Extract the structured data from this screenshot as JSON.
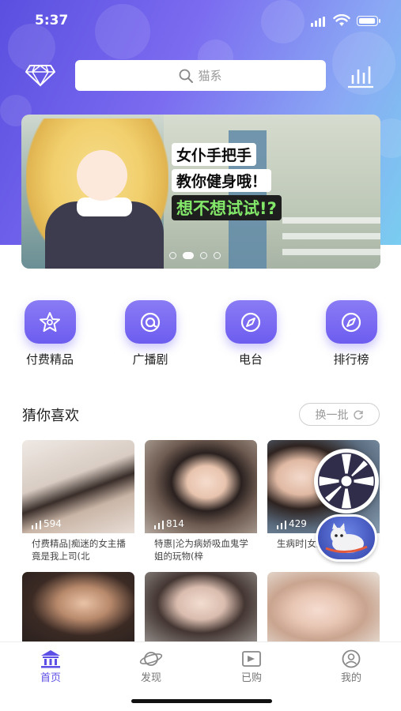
{
  "status_bar": {
    "time": "5:37"
  },
  "search": {
    "placeholder": "猫系"
  },
  "banner": {
    "lines": [
      "女仆手把手",
      "教你健身哦！",
      "想不想试试!?"
    ],
    "page_count": 4,
    "active_index": 1
  },
  "categories": [
    {
      "label": "付费精品",
      "icon": "star-icon"
    },
    {
      "label": "广播剧",
      "icon": "at-icon"
    },
    {
      "label": "电台",
      "icon": "compass-icon"
    },
    {
      "label": "排行榜",
      "icon": "compass-icon"
    }
  ],
  "recommend": {
    "title": "猜你喜欢",
    "refresh_label": "换一批",
    "cards": [
      {
        "plays": "594",
        "caption": "付费精品|痴迷的女主播竟是我上司(北"
      },
      {
        "plays": "814",
        "caption": "特惠|沦为病娇吸血鬼学姐的玩物(梓"
      },
      {
        "plays": "429",
        "caption": "生病时|女友(狸,"
      }
    ]
  },
  "tabbar": {
    "items": [
      {
        "label": "首页",
        "icon": "home-icon",
        "active": true
      },
      {
        "label": "发现",
        "icon": "planet-icon",
        "active": false
      },
      {
        "label": "已购",
        "icon": "purchased-icon",
        "active": false
      },
      {
        "label": "我的",
        "icon": "profile-icon",
        "active": false
      }
    ]
  },
  "colors": {
    "accent": "#5c4fe6",
    "header_start": "#5a4fe0",
    "header_end": "#79cdf0"
  }
}
